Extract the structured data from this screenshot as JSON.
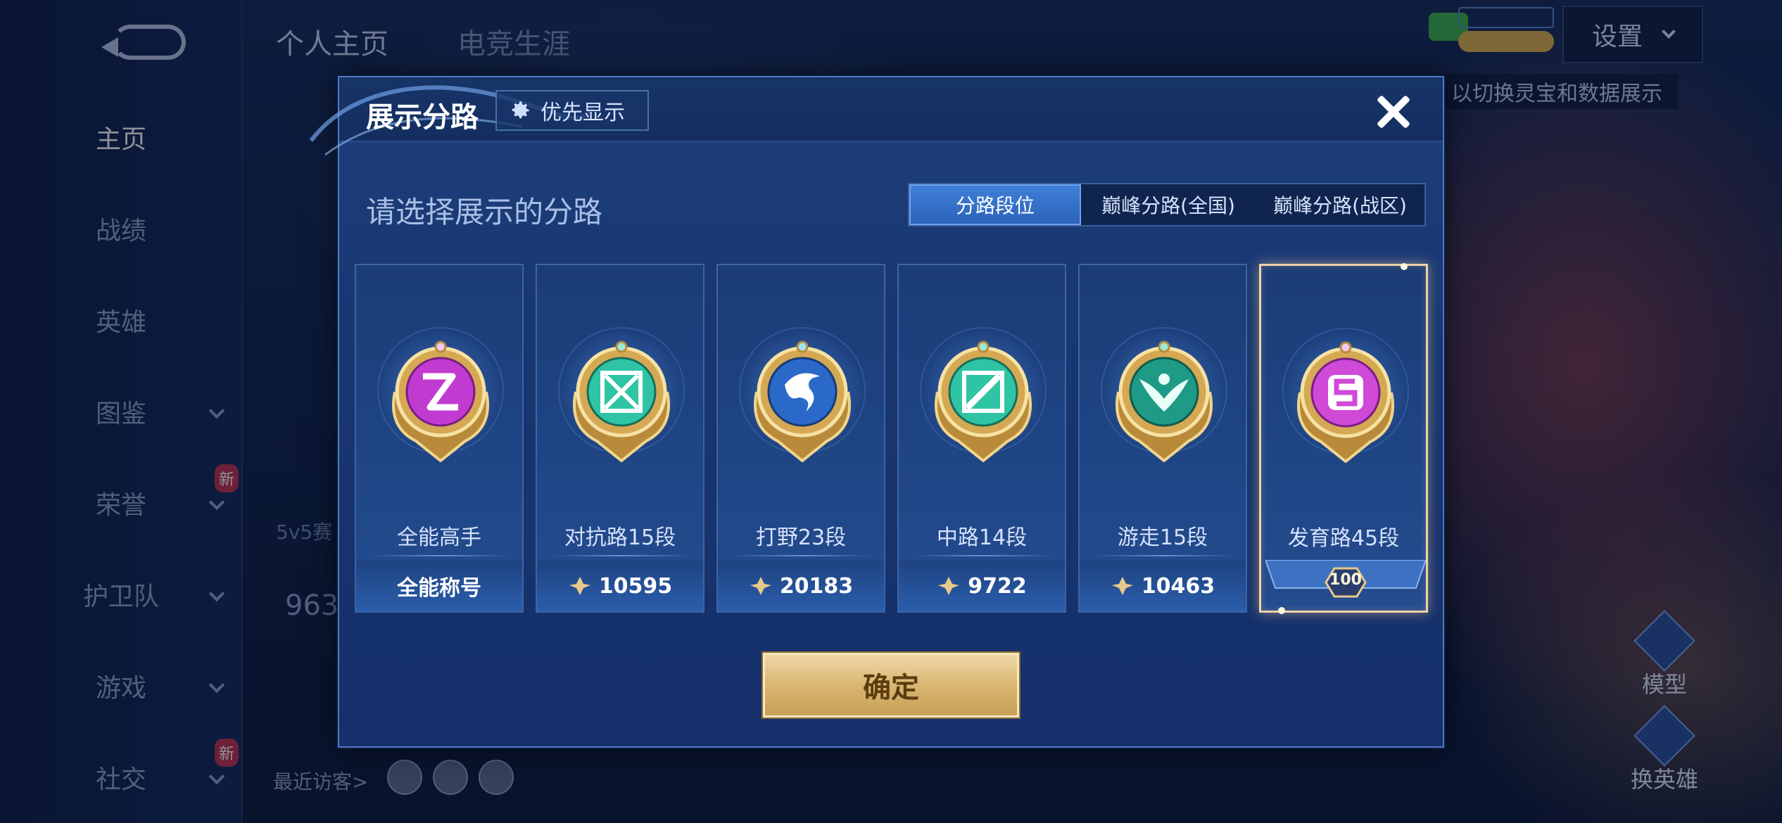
{
  "background": {
    "top_tabs": [
      "个人主页",
      "电竞生涯"
    ],
    "settings_label": "设置",
    "hint_text": "以切换灵宝和数据展示",
    "sidebar": {
      "items": [
        {
          "label": "主页",
          "active": true
        },
        {
          "label": "战绩"
        },
        {
          "label": "英雄"
        },
        {
          "label": "图鉴",
          "has_chevron": true
        },
        {
          "label": "荣誉",
          "has_chevron": true,
          "badge": "新"
        },
        {
          "label": "护卫队",
          "has_chevron": true
        },
        {
          "label": "游戏",
          "has_chevron": true
        },
        {
          "label": "社交",
          "has_chevron": true,
          "badge": "新"
        }
      ]
    },
    "faint_5v5": "5v5赛",
    "faint_number": "963",
    "recent_visitors_label": "最近访客>",
    "right_buttons": [
      "模型",
      "换英雄"
    ],
    "badge_new": "新"
  },
  "modal": {
    "title": "展示分路",
    "priority_button_label": "优先显示",
    "subtitle": "请选择展示的分路",
    "segments": [
      "分路段位",
      "巅峰分路(全国)",
      "巅峰分路(战区)"
    ],
    "selected_segment": 0,
    "cards": [
      {
        "name": "全能高手",
        "footer": "全能称号",
        "has_points_icon": false,
        "emblem": "all-round",
        "gem": "#c23bd0"
      },
      {
        "name": "对抗路15段",
        "footer": "10595",
        "has_points_icon": true,
        "emblem": "clash-lane",
        "gem": "#2fc4a4"
      },
      {
        "name": "打野23段",
        "footer": "20183",
        "has_points_icon": true,
        "emblem": "jungle",
        "gem": "#2b69c8"
      },
      {
        "name": "中路14段",
        "footer": "9722",
        "has_points_icon": true,
        "emblem": "mid-lane",
        "gem": "#2fc4a4"
      },
      {
        "name": "游走15段",
        "footer": "10463",
        "has_points_icon": true,
        "emblem": "roam",
        "gem": "#1f9a86"
      },
      {
        "name": "发育路45段",
        "footer": "",
        "level": "100",
        "selected": true,
        "emblem": "farm-lane",
        "gem": "#d04ad8"
      }
    ],
    "confirm_label": "确定"
  },
  "colors": {
    "accent_blue": "#3f7fd8",
    "gold": "#d9b672",
    "selected_border": "#f0d2a6"
  }
}
